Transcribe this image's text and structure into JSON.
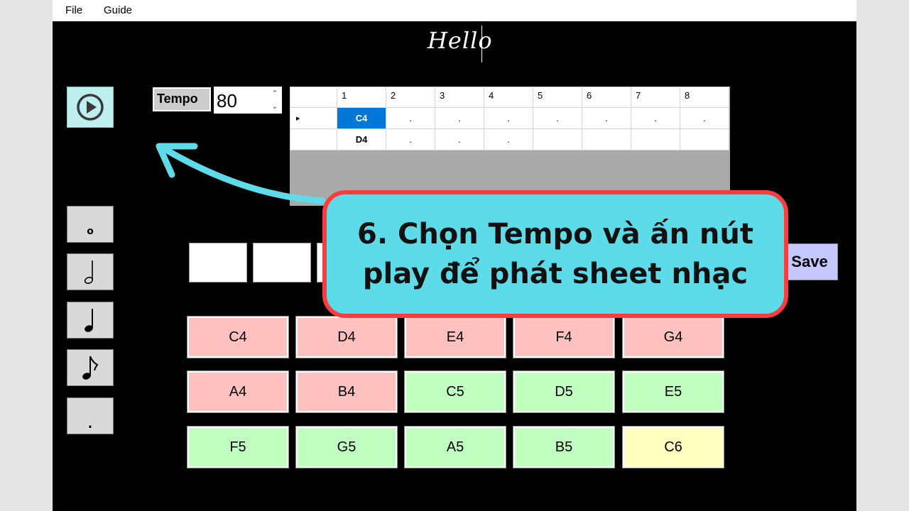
{
  "menu": {
    "file": "File",
    "guide": "Guide"
  },
  "title_text": "Hello",
  "tempo": {
    "label": "Tempo",
    "value": "80"
  },
  "grid": {
    "columns": [
      "1",
      "2",
      "3",
      "4",
      "5",
      "6",
      "7",
      "8"
    ],
    "rows": [
      {
        "marker": "▸",
        "cells": [
          "C4",
          ".",
          ".",
          ".",
          ".",
          ".",
          ".",
          "."
        ]
      },
      {
        "marker": "",
        "cells": [
          "D4",
          ".",
          ".",
          ".",
          "",
          "",
          "",
          ""
        ]
      }
    ]
  },
  "durations": [
    {
      "name": "whole-note-button",
      "symbol": "𝅝"
    },
    {
      "name": "half-note-button",
      "symbol": "𝅗𝅥"
    },
    {
      "name": "quarter-note-button",
      "symbol": "♩"
    },
    {
      "name": "eighth-note-button",
      "symbol": "♪"
    },
    {
      "name": "dot-button",
      "symbol": "."
    }
  ],
  "save_label": "Save",
  "keys": [
    {
      "label": "C4",
      "color": "#ffc0c0"
    },
    {
      "label": "D4",
      "color": "#ffc0c0"
    },
    {
      "label": "E4",
      "color": "#ffc0c0"
    },
    {
      "label": "F4",
      "color": "#ffc0c0"
    },
    {
      "label": "G4",
      "color": "#ffc0c0"
    },
    {
      "label": "A4",
      "color": "#ffc0c0"
    },
    {
      "label": "B4",
      "color": "#ffc0c0"
    },
    {
      "label": "C5",
      "color": "#c0ffc0"
    },
    {
      "label": "D5",
      "color": "#c0ffc0"
    },
    {
      "label": "E5",
      "color": "#c0ffc0"
    },
    {
      "label": "F5",
      "color": "#c0ffc0"
    },
    {
      "label": "G5",
      "color": "#c0ffc0"
    },
    {
      "label": "A5",
      "color": "#c0ffc0"
    },
    {
      "label": "B5",
      "color": "#c0ffc0"
    },
    {
      "label": "C6",
      "color": "#ffffc0"
    }
  ],
  "callout": {
    "line1": "6. Chọn Tempo và ấn nút",
    "line2": "play để phát sheet nhạc"
  },
  "colors": {
    "accent_cyan": "#5ddbe8",
    "callout_border": "#ff3c3c",
    "selected_cell": "#0078d7"
  }
}
